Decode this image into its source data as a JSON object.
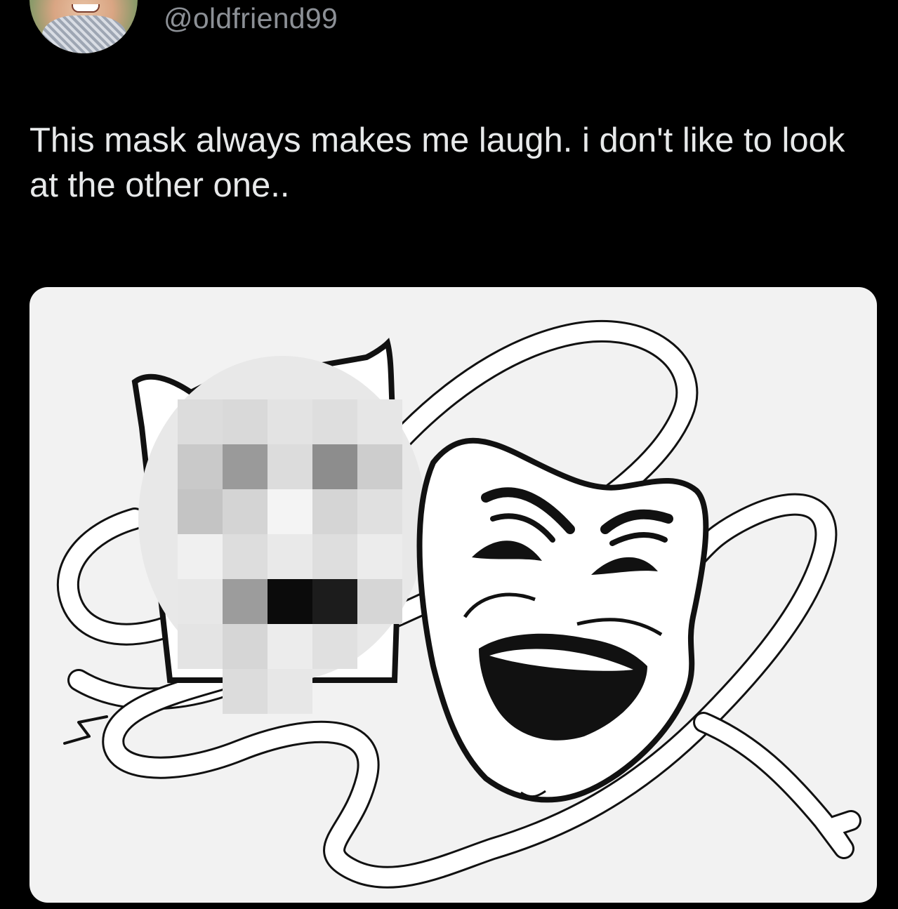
{
  "post": {
    "handle": "@oldfriend99",
    "text": "This mask always makes me laugh. i don't like to look at the other one.."
  },
  "icons": {
    "avatar": "profile-photo",
    "media": "comedy-tragedy-masks-illustration"
  },
  "colors": {
    "background": "#000000",
    "text": "#e7e9ea",
    "handle": "#8c9096",
    "media_background": "#f2f2f2"
  }
}
